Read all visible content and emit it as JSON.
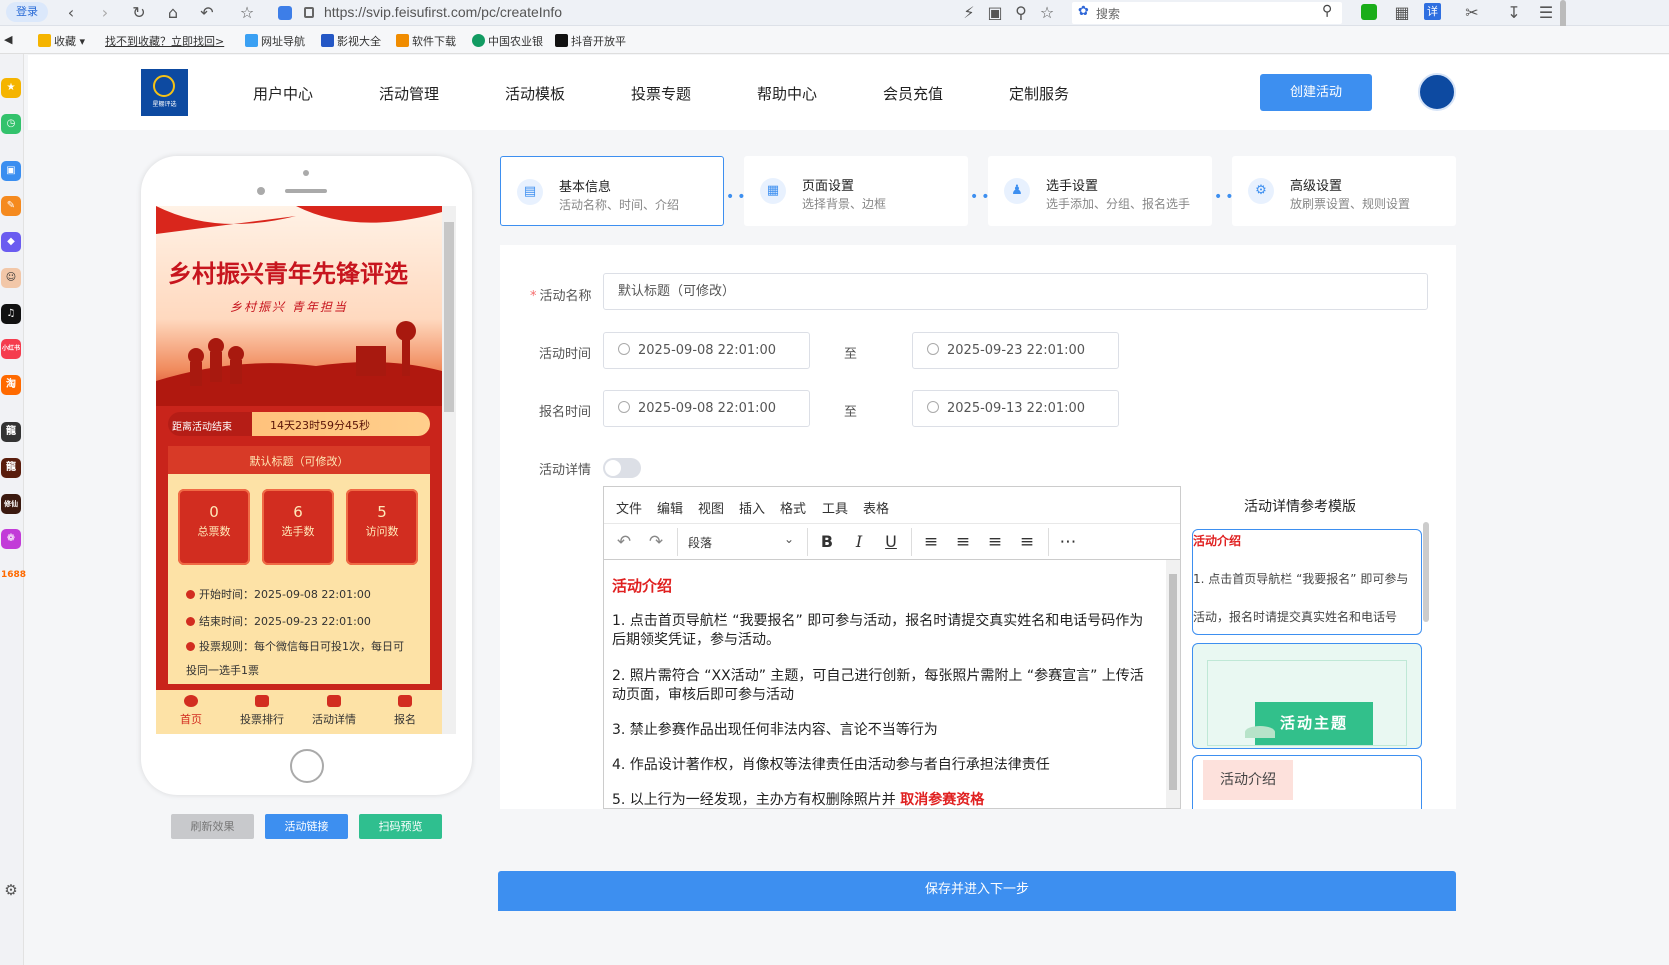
{
  "browser": {
    "login_badge": "登录",
    "url": "https://svip.feisufirst.com/pc/createInfo",
    "search_placeholder": "搜索",
    "translate_badge": "详"
  },
  "bookmarks": {
    "favorites": "收藏",
    "not_found": "找不到收藏？立即找回>",
    "items": [
      "网址导航",
      "影视大全",
      "软件下载",
      "中国农业银",
      "抖音开放平"
    ]
  },
  "sidebar_apps": {
    "xiaohongshu": "小红书",
    "taobao": "淘",
    "long": "龍",
    "long2": "龍",
    "game": "修仙",
    "b1688": "1688"
  },
  "header": {
    "logo_text": "星棚评选",
    "menu": [
      "用户中心",
      "活动管理",
      "活动模板",
      "投票专题",
      "帮助中心",
      "会员充值",
      "定制服务"
    ],
    "create_button": "创建活动"
  },
  "preview": {
    "hero_title": "乡村振兴青年先锋评选",
    "hero_subtitle": "乡村振兴 青年担当",
    "countdown_label": "距离活动结束",
    "countdown_value": "14天23时59分45秒",
    "card_title": "默认标题（可修改）",
    "stats": [
      {
        "value": "0",
        "label": "总票数"
      },
      {
        "value": "6",
        "label": "选手数"
      },
      {
        "value": "5",
        "label": "访问数"
      }
    ],
    "start_time": "开始时间：2025-09-08 22:01:00",
    "end_time": "结束时间：2025-09-23 22:01:00",
    "rule_line1": "投票规则：每个微信每日可投1次，每日可",
    "rule_line2": "投同一选手1票",
    "tabs": [
      "首页",
      "投票排行",
      "活动详情",
      "报名"
    ]
  },
  "preview_buttons": {
    "refresh": "刷新效果",
    "link": "活动链接",
    "scan": "扫码预览"
  },
  "steps": [
    {
      "title": "基本信息",
      "desc": "活动名称、时间、介绍"
    },
    {
      "title": "页面设置",
      "desc": "选择背景、边框"
    },
    {
      "title": "选手设置",
      "desc": "选手添加、分组、报名选手"
    },
    {
      "title": "高级设置",
      "desc": "放刷票设置、规则设置"
    }
  ],
  "form": {
    "name_label": "活动名称",
    "name_value": "默认标题（可修改）",
    "time_label": "活动时间",
    "time_start": "2025-09-08 22:01:00",
    "time_end": "2025-09-23 22:01:00",
    "signup_label": "报名时间",
    "signup_start": "2025-09-08 22:01:00",
    "signup_end": "2025-09-13 22:01:00",
    "to_label": "至",
    "detail_label": "活动详情",
    "detail_enabled": false
  },
  "editor": {
    "menus": [
      "文件",
      "编辑",
      "视图",
      "插入",
      "格式",
      "工具",
      "表格"
    ],
    "paragraph_select": "段落",
    "heading": "活动介绍",
    "p1": "1. 点击首页导航栏 “我要报名” 即可参与活动，报名时请提交真实姓名和电话号码作为后期领奖凭证，参与活动。",
    "p2": "2. 照片需符合 “XX活动” 主题，可自己进行创新，每张照片需附上 “参赛宣言” 上传活动页面，审核后即可参与活动",
    "p3": "3. 禁止参赛作品出现任何非法内容、言论不当等行为",
    "p4": "4. 作品设计著作权，肖像权等法律责任由活动参与者自行承担法律责任",
    "p5_prefix": "5. 以上行为一经发现，主办方有权删除照片并 ",
    "p5_highlight": "取消参赛资格"
  },
  "templates": {
    "title": "活动详情参考模版",
    "t1_heading": "活动介绍",
    "t1_line1": "1. 点击首页导航栏 “我要报名” 即可参与",
    "t1_line2": "活动，报名时请提交真实姓名和电话号",
    "t2_label": "活动主题",
    "t3_label": "活动介绍"
  },
  "save_button": "保存并进入下一步",
  "colors": {
    "primary": "#3d8ff0",
    "festive_red": "#c9241b",
    "highlight_red": "#e02020",
    "green": "#2fbf8f"
  }
}
